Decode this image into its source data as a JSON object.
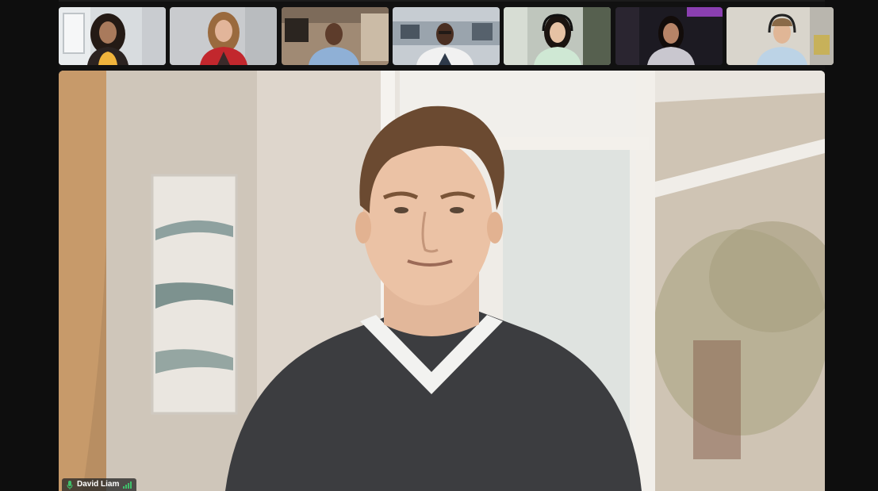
{
  "meeting": {
    "active_speaker": {
      "name": "David Liam"
    },
    "participants": [
      {
        "id": "p1"
      },
      {
        "id": "p2"
      },
      {
        "id": "p3"
      },
      {
        "id": "p4"
      },
      {
        "id": "p5"
      },
      {
        "id": "p6"
      },
      {
        "id": "p7"
      }
    ]
  },
  "colors": {
    "background": "#111111",
    "name_tag_bg": "#282828",
    "speaking_indicator": "#3fbf6a"
  },
  "icons": {
    "mic": "mic-icon",
    "signal": "signal-bars-icon"
  }
}
